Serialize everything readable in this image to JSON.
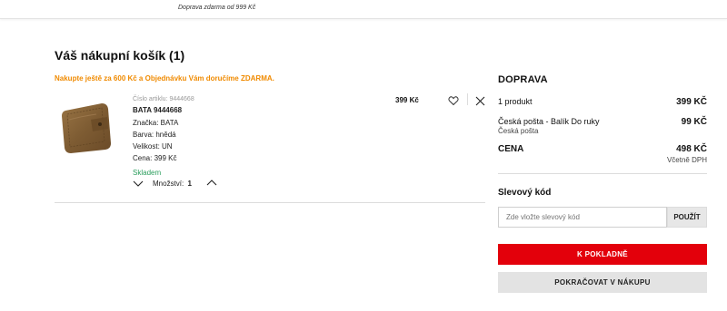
{
  "topbar": {
    "promo": "Doprava zdarma od 999 Kč"
  },
  "cart": {
    "title": "Váš nákupní košík (1)",
    "threshold_msg": "Nakupte ještě za 600 Kč a Objednávku Vám doručíme ZDARMA."
  },
  "item": {
    "article_number": "Číslo artiklu: 9444668",
    "name": "BATA 9444668",
    "brand": "Značka: BATA",
    "color": "Barva: hnědá",
    "size": "Velikost: UN",
    "price_line": "Cena: 399 Kč",
    "stock": "Skladem",
    "quantity_label": "Množství:",
    "quantity": "1",
    "price": "399 Kč",
    "icons": [
      "product-image",
      "chevron-down-icon",
      "chevron-up-icon",
      "heart-icon",
      "close-icon"
    ]
  },
  "summary": {
    "title": "DOPRAVA",
    "products_label": "1 produkt",
    "products_value": "399 KČ",
    "shipping_label": "Česká pošta - Balík Do ruky",
    "shipping_sub": "Česká pošta",
    "shipping_value": "99 KČ",
    "total_label": "CENA",
    "total_value": "498 KČ",
    "vat_note": "Včetně DPH"
  },
  "coupon": {
    "title": "Slevový kód",
    "placeholder": "Zde vložte slevový kód",
    "apply_label": "POUŽÍT"
  },
  "actions": {
    "checkout_label": "K POKLADNĚ",
    "continue_label": "POKRAČOVAT V NÁKUPU"
  },
  "colors": {
    "accent_red": "#e3000b",
    "threshold_orange": "#f08a00",
    "stock_green": "#2a9d5c"
  }
}
